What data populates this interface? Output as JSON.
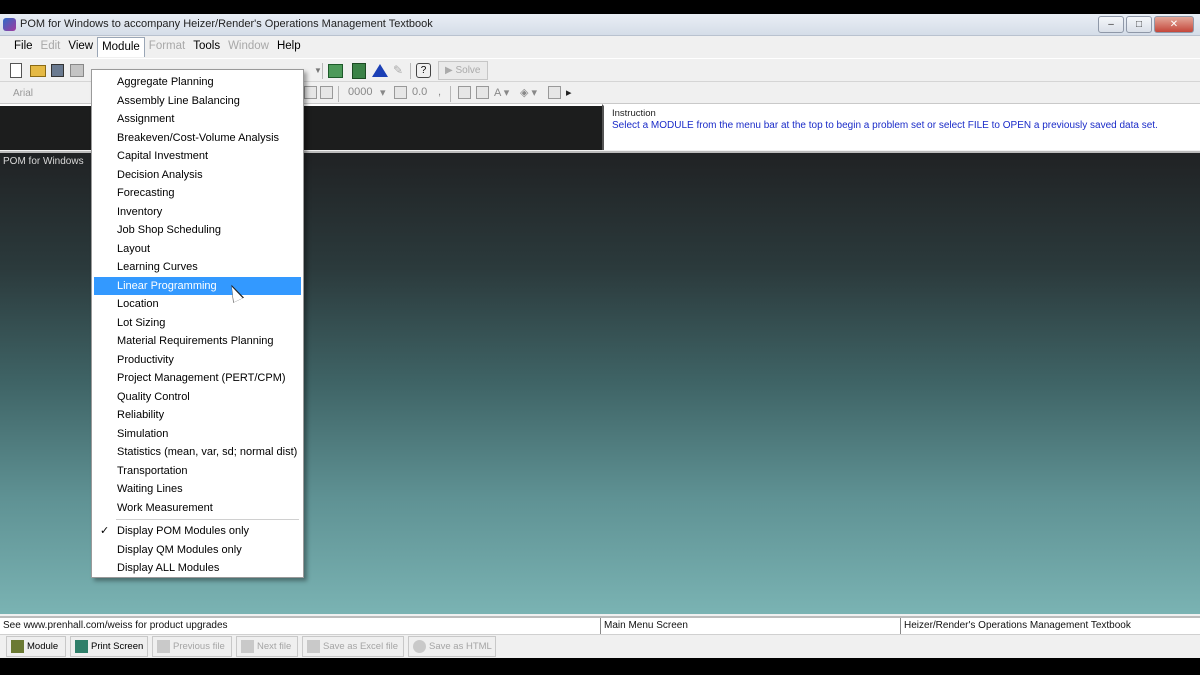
{
  "window": {
    "title": "POM for Windows to accompany Heizer/Render's Operations Management Textbook",
    "controls": [
      "–",
      "□",
      "✕"
    ]
  },
  "menubar": [
    {
      "label": "File",
      "enabled": true
    },
    {
      "label": "Edit",
      "enabled": false
    },
    {
      "label": "View",
      "enabled": true
    },
    {
      "label": "Module",
      "enabled": true
    },
    {
      "label": "Format",
      "enabled": false
    },
    {
      "label": "Tools",
      "enabled": true
    },
    {
      "label": "Window",
      "enabled": false
    },
    {
      "label": "Help",
      "enabled": true
    }
  ],
  "toolbar": {
    "solve_label": "Solve",
    "font_name": "Arial",
    "number_format": "0000",
    "decimal_format": "0.0"
  },
  "instruction": {
    "label": "Instruction",
    "text": "Select a MODULE from the menu bar at the top to begin a problem set or select FILE to OPEN a previously saved data set."
  },
  "main": {
    "label": "POM for Windows"
  },
  "module_menu": {
    "items": [
      "Aggregate Planning",
      "Assembly Line Balancing",
      "Assignment",
      "Breakeven/Cost-Volume Analysis",
      "Capital Investment",
      "Decision Analysis",
      "Forecasting",
      "Inventory",
      "Job Shop Scheduling",
      "Layout",
      "Learning Curves",
      "Linear Programming",
      "Location",
      "Lot Sizing",
      "Material Requirements Planning",
      "Productivity",
      "Project Management (PERT/CPM)",
      "Quality Control",
      "Reliability",
      "Simulation",
      "Statistics (mean, var, sd; normal dist)",
      "Transportation",
      "Waiting Lines",
      "Work Measurement"
    ],
    "selected": "Linear Programming",
    "display_options": [
      {
        "label": "Display POM Modules only",
        "checked": true
      },
      {
        "label": "Display QM Modules only",
        "checked": false
      },
      {
        "label": "Display ALL Modules",
        "checked": false
      }
    ]
  },
  "statusbar": {
    "left": "See www.prenhall.com/weiss for product upgrades",
    "middle": "Main Menu Screen",
    "right": "Heizer/Render's Operations Management Textbook"
  },
  "bottom_buttons": [
    {
      "label": "Module",
      "enabled": true
    },
    {
      "label": "Print Screen",
      "enabled": true
    },
    {
      "label": "Previous file",
      "enabled": false
    },
    {
      "label": "Next file",
      "enabled": false
    },
    {
      "label": "Save as Excel file",
      "enabled": false
    },
    {
      "label": "Save as HTML",
      "enabled": false
    }
  ],
  "colors": {
    "menu_highlight": "#3399ff",
    "instruction_text": "#1a2bc8"
  }
}
